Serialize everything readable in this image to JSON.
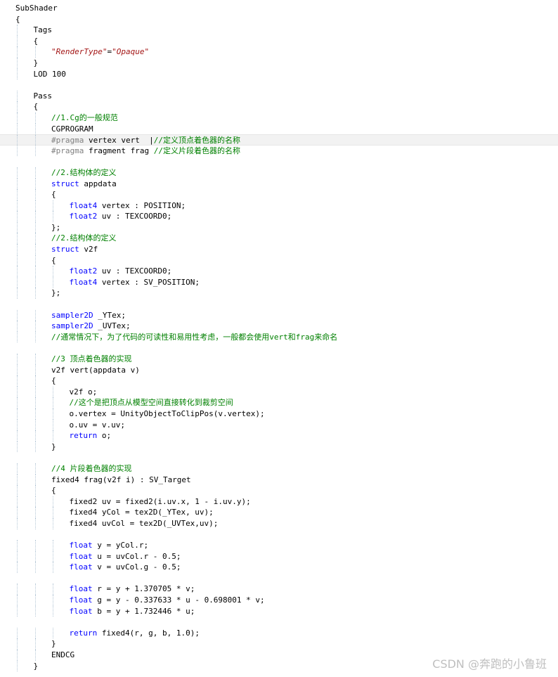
{
  "editor": {
    "lines": [
      {
        "d": 0,
        "s": [
          {
            "t": "SubShader",
            "c": "pl"
          }
        ]
      },
      {
        "d": 0,
        "s": [
          {
            "t": "{",
            "c": "pl"
          }
        ]
      },
      {
        "d": 1,
        "s": [
          {
            "t": "Tags",
            "c": "pl"
          }
        ]
      },
      {
        "d": 1,
        "s": [
          {
            "t": "{",
            "c": "pl"
          }
        ]
      },
      {
        "d": 2,
        "s": [
          {
            "t": "\"RenderType\"",
            "c": "st"
          },
          {
            "t": "=",
            "c": "pl"
          },
          {
            "t": "\"Opaque\"",
            "c": "st"
          }
        ]
      },
      {
        "d": 1,
        "s": [
          {
            "t": "}",
            "c": "pl"
          }
        ]
      },
      {
        "d": 1,
        "s": [
          {
            "t": "LOD 100",
            "c": "pl"
          }
        ]
      },
      {
        "d": 0,
        "s": []
      },
      {
        "d": 1,
        "s": [
          {
            "t": "Pass",
            "c": "pl"
          }
        ]
      },
      {
        "d": 1,
        "s": [
          {
            "t": "{",
            "c": "pl"
          }
        ]
      },
      {
        "d": 2,
        "s": [
          {
            "t": "//1.Cg的一般规范",
            "c": "cm"
          }
        ]
      },
      {
        "d": 2,
        "s": [
          {
            "t": "CGPROGRAM",
            "c": "pl"
          }
        ]
      },
      {
        "d": 2,
        "hl": true,
        "s": [
          {
            "t": "#pragma",
            "c": "pp"
          },
          {
            "t": " vertex vert  |",
            "c": "pl"
          },
          {
            "t": "//定义顶点着色器的名称",
            "c": "cm"
          }
        ]
      },
      {
        "d": 2,
        "s": [
          {
            "t": "#pragma",
            "c": "pp"
          },
          {
            "t": " fragment frag ",
            "c": "pl"
          },
          {
            "t": "//定义片段着色器的名称",
            "c": "cm"
          }
        ]
      },
      {
        "d": 0,
        "s": []
      },
      {
        "d": 2,
        "s": [
          {
            "t": "//2.结构体的定义",
            "c": "cm"
          }
        ]
      },
      {
        "d": 2,
        "s": [
          {
            "t": "struct",
            "c": "kw"
          },
          {
            "t": " appdata",
            "c": "pl"
          }
        ]
      },
      {
        "d": 2,
        "s": [
          {
            "t": "{",
            "c": "pl"
          }
        ]
      },
      {
        "d": 3,
        "s": [
          {
            "t": "float4",
            "c": "kw"
          },
          {
            "t": " vertex : POSITION;",
            "c": "pl"
          }
        ]
      },
      {
        "d": 3,
        "s": [
          {
            "t": "float2",
            "c": "kw"
          },
          {
            "t": " uv : TEXCOORD0;",
            "c": "pl"
          }
        ]
      },
      {
        "d": 2,
        "s": [
          {
            "t": "};",
            "c": "pl"
          }
        ]
      },
      {
        "d": 2,
        "s": [
          {
            "t": "//2.结构体的定义",
            "c": "cm"
          }
        ]
      },
      {
        "d": 2,
        "s": [
          {
            "t": "struct",
            "c": "kw"
          },
          {
            "t": " v2f",
            "c": "pl"
          }
        ]
      },
      {
        "d": 2,
        "s": [
          {
            "t": "{",
            "c": "pl"
          }
        ]
      },
      {
        "d": 3,
        "s": [
          {
            "t": "float2",
            "c": "kw"
          },
          {
            "t": " uv : TEXCOORD0;",
            "c": "pl"
          }
        ]
      },
      {
        "d": 3,
        "s": [
          {
            "t": "float4",
            "c": "kw"
          },
          {
            "t": " vertex : SV_POSITION;",
            "c": "pl"
          }
        ]
      },
      {
        "d": 2,
        "s": [
          {
            "t": "};",
            "c": "pl"
          }
        ]
      },
      {
        "d": 0,
        "s": []
      },
      {
        "d": 2,
        "s": [
          {
            "t": "sampler2D",
            "c": "kw"
          },
          {
            "t": " _YTex; ",
            "c": "pl"
          }
        ]
      },
      {
        "d": 2,
        "s": [
          {
            "t": "sampler2D",
            "c": "kw"
          },
          {
            "t": " _UVTex; ",
            "c": "pl"
          }
        ]
      },
      {
        "d": 2,
        "s": [
          {
            "t": "//通常情况下，为了代码的可读性和易用性考虑，一般都会使用vert和frag来命名",
            "c": "cm"
          }
        ]
      },
      {
        "d": 0,
        "s": []
      },
      {
        "d": 2,
        "s": [
          {
            "t": "//3 顶点着色器的实现",
            "c": "cm"
          }
        ]
      },
      {
        "d": 2,
        "s": [
          {
            "t": "v2f vert(appdata v)",
            "c": "pl"
          }
        ]
      },
      {
        "d": 2,
        "s": [
          {
            "t": "{",
            "c": "pl"
          }
        ]
      },
      {
        "d": 3,
        "s": [
          {
            "t": "v2f o;",
            "c": "pl"
          }
        ]
      },
      {
        "d": 3,
        "s": [
          {
            "t": "//这个是把顶点从模型空间直接转化到裁剪空间",
            "c": "cm"
          }
        ]
      },
      {
        "d": 3,
        "s": [
          {
            "t": "o.vertex = UnityObjectToClipPos(v.vertex);",
            "c": "pl"
          }
        ]
      },
      {
        "d": 3,
        "s": [
          {
            "t": "o.uv = v.uv;",
            "c": "pl"
          }
        ]
      },
      {
        "d": 3,
        "s": [
          {
            "t": "return",
            "c": "kw"
          },
          {
            "t": " o;",
            "c": "pl"
          }
        ]
      },
      {
        "d": 2,
        "s": [
          {
            "t": "}",
            "c": "pl"
          }
        ]
      },
      {
        "d": 0,
        "s": []
      },
      {
        "d": 2,
        "s": [
          {
            "t": "//4 片段着色器的实现",
            "c": "cm"
          }
        ]
      },
      {
        "d": 2,
        "s": [
          {
            "t": "fixed4 frag(v2f i) : SV_Target",
            "c": "pl"
          }
        ]
      },
      {
        "d": 2,
        "s": [
          {
            "t": "{",
            "c": "pl"
          }
        ]
      },
      {
        "d": 3,
        "s": [
          {
            "t": "fixed2 uv = fixed2(i.uv.x, 1 - i.uv.y);",
            "c": "pl"
          }
        ]
      },
      {
        "d": 3,
        "s": [
          {
            "t": "fixed4 yCol = tex2D(_YTex, uv);",
            "c": "pl"
          }
        ]
      },
      {
        "d": 3,
        "s": [
          {
            "t": "fixed4 uvCol = tex2D(_UVTex,uv);",
            "c": "pl"
          }
        ]
      },
      {
        "d": 0,
        "s": []
      },
      {
        "d": 3,
        "s": [
          {
            "t": "float",
            "c": "kw"
          },
          {
            "t": " y = yCol.r;",
            "c": "pl"
          }
        ]
      },
      {
        "d": 3,
        "s": [
          {
            "t": "float",
            "c": "kw"
          },
          {
            "t": " u = uvCol.r - 0.5;",
            "c": "pl"
          }
        ]
      },
      {
        "d": 3,
        "s": [
          {
            "t": "float",
            "c": "kw"
          },
          {
            "t": " v = uvCol.g - 0.5;",
            "c": "pl"
          }
        ]
      },
      {
        "d": 0,
        "s": []
      },
      {
        "d": 3,
        "s": [
          {
            "t": "float",
            "c": "kw"
          },
          {
            "t": " r = y + 1.370705 * v;",
            "c": "pl"
          }
        ]
      },
      {
        "d": 3,
        "s": [
          {
            "t": "float",
            "c": "kw"
          },
          {
            "t": " g = y - 0.337633 * u - 0.698001 * v;",
            "c": "pl"
          }
        ]
      },
      {
        "d": 3,
        "s": [
          {
            "t": "float",
            "c": "kw"
          },
          {
            "t": " b = y + 1.732446 * u;",
            "c": "pl"
          }
        ]
      },
      {
        "d": 0,
        "s": []
      },
      {
        "d": 3,
        "s": [
          {
            "t": "return",
            "c": "kw"
          },
          {
            "t": " fixed4(r, g, b, 1.0);",
            "c": "pl"
          }
        ]
      },
      {
        "d": 2,
        "s": [
          {
            "t": "}",
            "c": "pl"
          }
        ]
      },
      {
        "d": 2,
        "s": [
          {
            "t": "ENDCG",
            "c": "pl"
          }
        ]
      },
      {
        "d": 1,
        "s": [
          {
            "t": "}",
            "c": "pl"
          }
        ]
      }
    ]
  },
  "watermark": "CSDN @奔跑的小鲁班"
}
